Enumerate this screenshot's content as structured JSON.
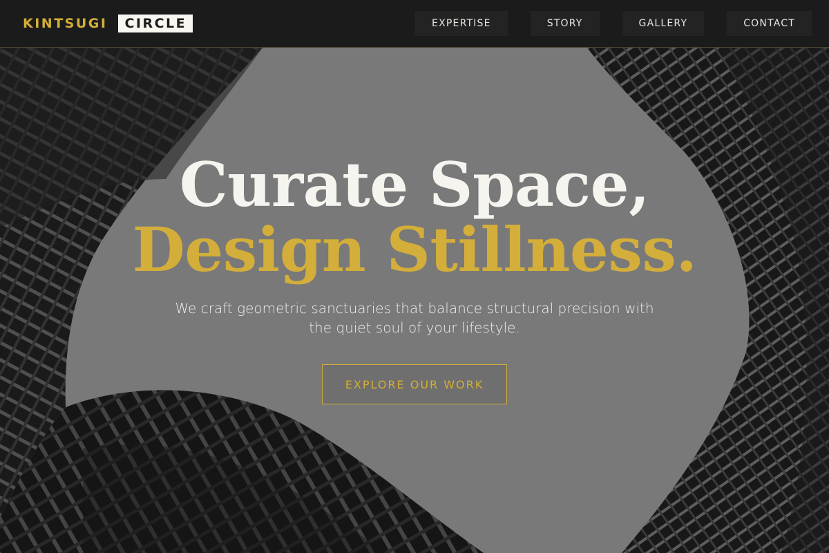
{
  "brand": {
    "part1": "KINTSUGI",
    "part2": "CIRCLE"
  },
  "nav": {
    "items": [
      {
        "label": "EXPERTISE"
      },
      {
        "label": "STORY"
      },
      {
        "label": "GALLERY"
      },
      {
        "label": "CONTACT"
      }
    ]
  },
  "hero": {
    "headline_line1": "Curate Space,",
    "headline_line2": "Design Stillness.",
    "subtext": "We craft geometric sanctuaries that balance structural precision with the quiet soul of your lifestyle.",
    "cta_label": "EXPLORE OUR WORK"
  },
  "colors": {
    "accent_gold": "#d4af37",
    "nav_background": "#1b1b1b",
    "headline_light": "#f6f4ee"
  }
}
